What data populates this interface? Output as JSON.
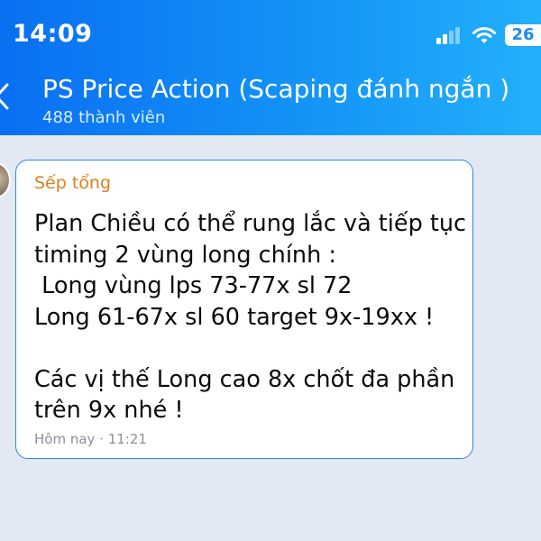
{
  "status_bar": {
    "time": "14:09",
    "battery": "26",
    "signal_icon": "signal-bars-icon",
    "wifi_icon": "wifi-icon"
  },
  "header": {
    "back_icon": "chevron-left-icon",
    "title": "PS Price Action (Scaping đánh ngắn )",
    "member_count": "488 thành viên",
    "color_start": "#0a6ff2",
    "color_end": "#23b0fa"
  },
  "message": {
    "sender": "Sếp tổng",
    "text": "Plan Chiều có thể rung lắc và tiếp tục\ntiming 2 vùng long chính :\n Long vùng lps 73-77x sl 72\nLong 61-67x sl 60 target 9x-19xx !\n\nCác vị thế Long cao 8x chốt đa phần\ntrên 9x nhé !",
    "time": "Hôm nay · 11:21",
    "sender_color": "#d9801c",
    "border_color": "#2f86e8"
  },
  "background_color": "#e3e9f2"
}
